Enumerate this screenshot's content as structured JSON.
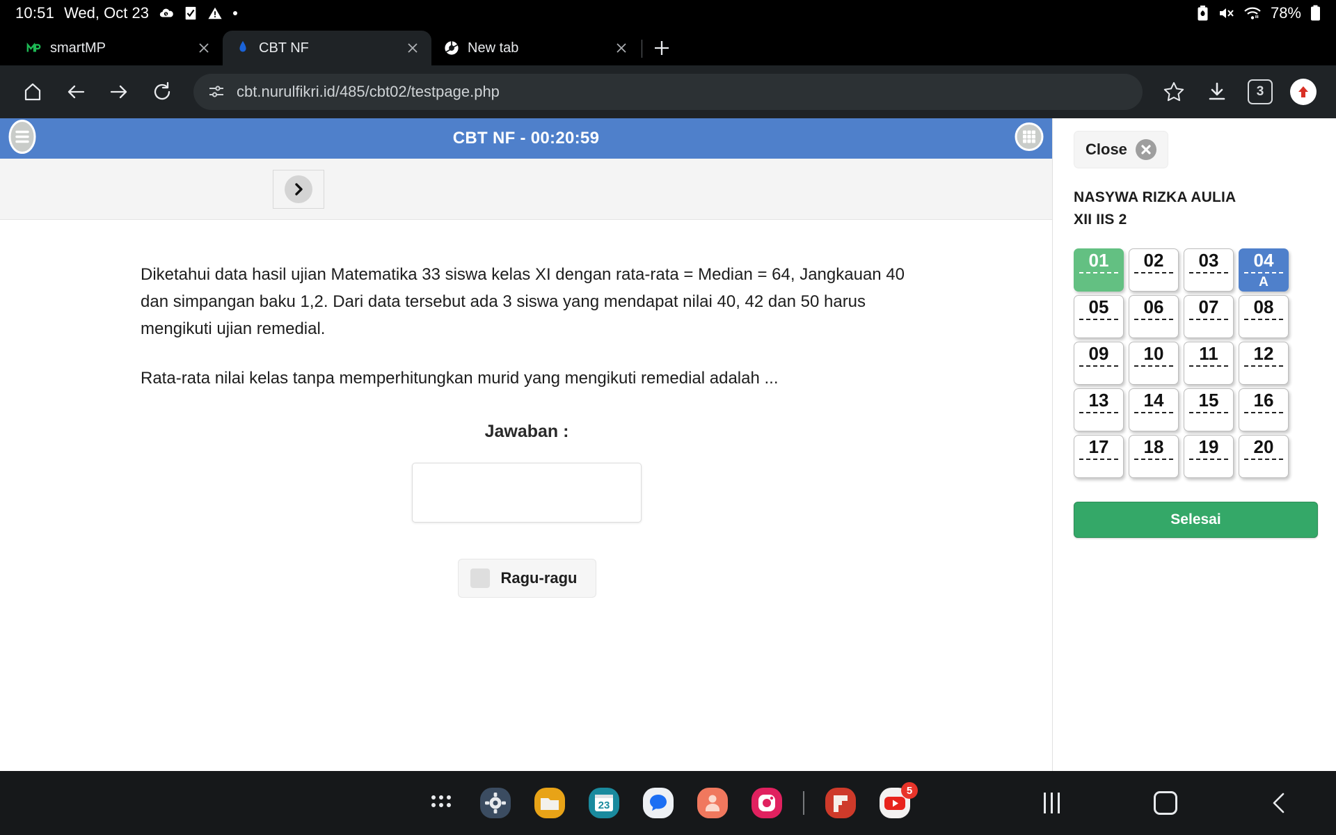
{
  "status_bar": {
    "time": "10:51",
    "date": "Wed, Oct 23",
    "battery_percent": "78%",
    "icons": [
      "cloud-sync-icon",
      "checkbox-checked-icon",
      "warning-icon",
      "dot-icon",
      "battery-saver-icon",
      "mute-icon",
      "wifi-icon",
      "battery-icon"
    ]
  },
  "browser": {
    "tabs": [
      {
        "title": "smartMP",
        "favicon": "smartmp-icon",
        "active": false
      },
      {
        "title": "CBT NF",
        "favicon": "cbt-icon",
        "active": true
      },
      {
        "title": "New tab",
        "favicon": "chrome-icon",
        "active": false
      }
    ],
    "new_tab_label": "+",
    "toolbar": {
      "home": "home-icon",
      "back": "back-icon",
      "forward": "forward-icon",
      "reload": "reload-icon",
      "site_info": "tune-icon",
      "url": "cbt.nurulfikri.id/485/cbt02/testpage.php",
      "bookmark": "star-icon",
      "download": "download-icon",
      "tab_count": "3",
      "profile": "profile-upload-icon"
    }
  },
  "cbt": {
    "header_title": "CBT NF - 00:20:59",
    "menu_icon": "hamburger-menu-icon",
    "grid_icon": "grid-menu-icon",
    "next_icon": "chevron-right-icon",
    "question_paragraphs": [
      "Diketahui data hasil ujian Matematika 33 siswa kelas XI dengan rata-rata = Median = 64, Jangkauan 40 dan simpangan baku 1,2. Dari data tersebut ada 3 siswa yang mendapat nilai 40, 42 dan 50 harus mengikuti ujian remedial.",
      "Rata-rata nilai kelas tanpa memperhitungkan murid yang mengikuti remedial adalah ..."
    ],
    "answer_label": "Jawaban :",
    "answer_value": "",
    "answer_placeholder": "",
    "doubt_label": "Ragu-ragu",
    "doubt_checked": false
  },
  "panel": {
    "close_label": "Close",
    "close_icon": "close-circle-icon",
    "student_name": "NASYWA RIZKA AULIA",
    "student_class": "XII IIS 2",
    "finish_label": "Selesai",
    "questions": [
      {
        "num": "01",
        "answer": "",
        "state": "answered"
      },
      {
        "num": "02",
        "answer": "",
        "state": "empty"
      },
      {
        "num": "03",
        "answer": "",
        "state": "empty"
      },
      {
        "num": "04",
        "answer": "A",
        "state": "current"
      },
      {
        "num": "05",
        "answer": "",
        "state": "empty"
      },
      {
        "num": "06",
        "answer": "",
        "state": "empty"
      },
      {
        "num": "07",
        "answer": "",
        "state": "empty"
      },
      {
        "num": "08",
        "answer": "",
        "state": "empty"
      },
      {
        "num": "09",
        "answer": "",
        "state": "empty"
      },
      {
        "num": "10",
        "answer": "",
        "state": "empty"
      },
      {
        "num": "11",
        "answer": "",
        "state": "empty"
      },
      {
        "num": "12",
        "answer": "",
        "state": "empty"
      },
      {
        "num": "13",
        "answer": "",
        "state": "empty"
      },
      {
        "num": "14",
        "answer": "",
        "state": "empty"
      },
      {
        "num": "15",
        "answer": "",
        "state": "empty"
      },
      {
        "num": "16",
        "answer": "",
        "state": "empty"
      },
      {
        "num": "17",
        "answer": "",
        "state": "empty"
      },
      {
        "num": "18",
        "answer": "",
        "state": "empty"
      },
      {
        "num": "19",
        "answer": "",
        "state": "empty"
      },
      {
        "num": "20",
        "answer": "",
        "state": "empty"
      }
    ]
  },
  "taskbar": {
    "icons": [
      {
        "name": "app-drawer-icon",
        "label": ""
      },
      {
        "name": "settings-icon",
        "label": ""
      },
      {
        "name": "files-icon",
        "label": ""
      },
      {
        "name": "calendar-icon",
        "label": "23"
      },
      {
        "name": "messages-icon",
        "label": ""
      },
      {
        "name": "contacts-icon",
        "label": ""
      },
      {
        "name": "instagram-icon",
        "label": ""
      },
      {
        "name": "divider",
        "label": ""
      },
      {
        "name": "flipboard-icon",
        "label": ""
      },
      {
        "name": "youtube-icon",
        "label": "",
        "badge": "5"
      }
    ],
    "nav": {
      "recents": "recents-icon",
      "home": "home-square-icon",
      "back": "back-chevron-icon"
    }
  },
  "colors": {
    "header_blue": "#4f80cb",
    "answered_green": "#63c082",
    "finish_green": "#34a868",
    "badge_red": "#e8342a"
  }
}
